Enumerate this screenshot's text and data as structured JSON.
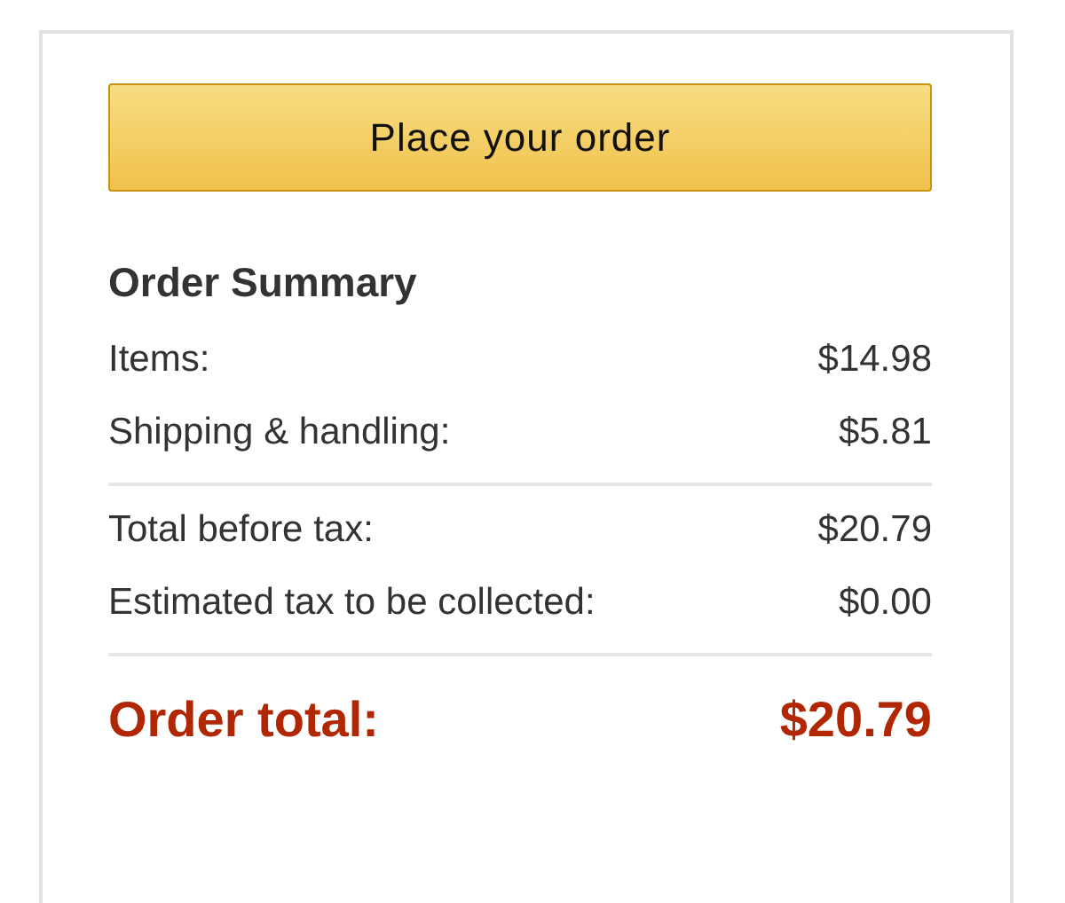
{
  "place_order_button": {
    "label": "Place your order"
  },
  "order_summary": {
    "title": "Order Summary",
    "groups": [
      {
        "rows": [
          {
            "label": "Items:",
            "value": "$14.98"
          },
          {
            "label": "Shipping & handling:",
            "value": "$5.81"
          }
        ]
      },
      {
        "rows": [
          {
            "label": "Total before tax:",
            "value": "$20.79"
          },
          {
            "label": "Estimated tax to be collected:",
            "value": "$0.00"
          }
        ]
      }
    ],
    "total": {
      "label": "Order total:",
      "value": "$20.79"
    }
  }
}
